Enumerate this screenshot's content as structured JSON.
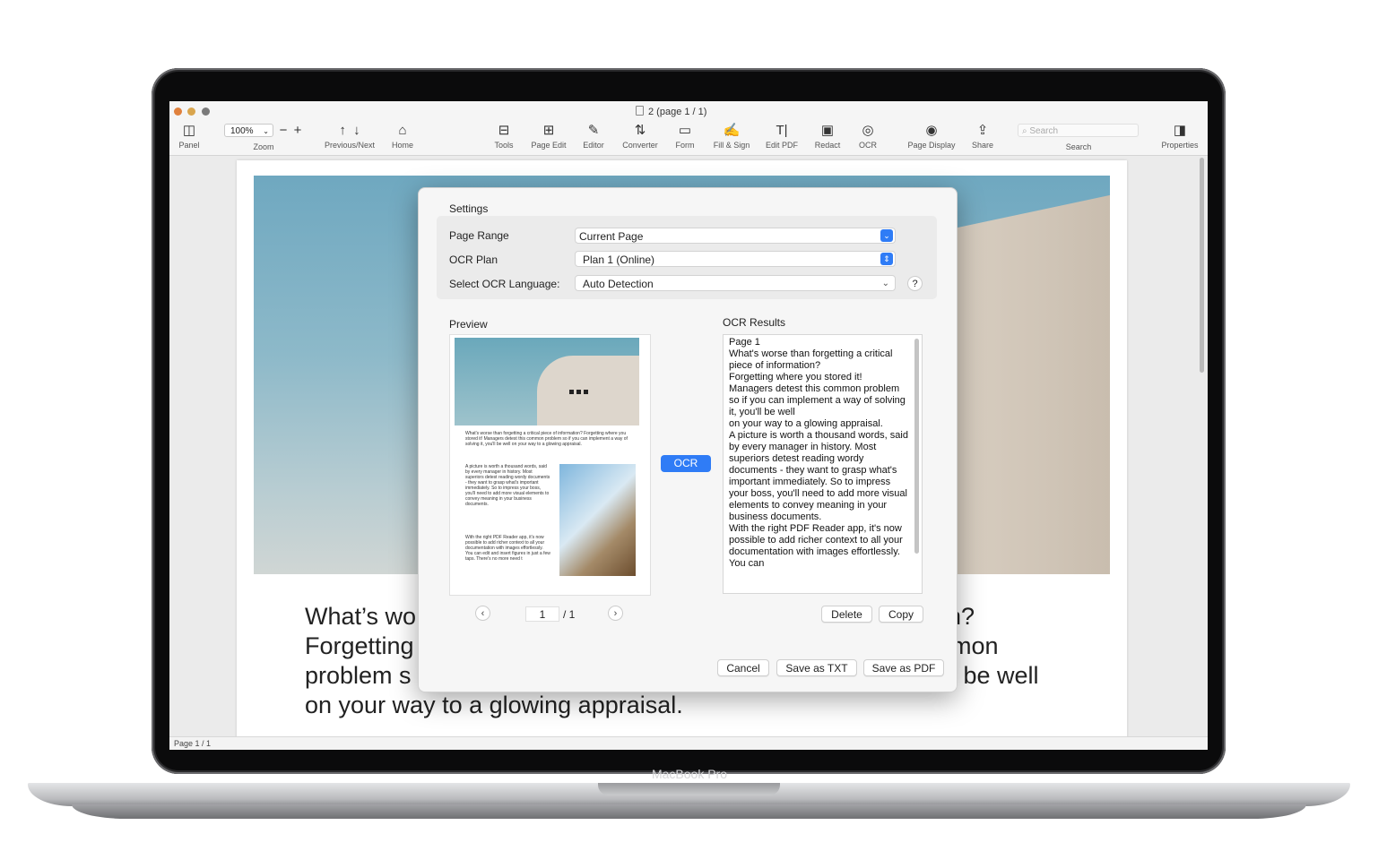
{
  "device": {
    "brand": "MacBook Pro"
  },
  "window": {
    "title": "2 (page 1 / 1)",
    "traffic_colors": [
      "#e0813d",
      "#d9a54d",
      "#7a7a7a"
    ]
  },
  "toolbar": {
    "panel": "Panel",
    "zoom_value": "100%",
    "zoom_minus": "−",
    "zoom_plus": "+",
    "zoom": "Zoom",
    "prev_next": "Previous/Next",
    "home": "Home",
    "tools": "Tools",
    "page_edit": "Page Edit",
    "editor": "Editor",
    "converter": "Converter",
    "form": "Form",
    "fill_sign": "Fill & Sign",
    "edit_pdf": "Edit PDF",
    "redact": "Redact",
    "ocr": "OCR",
    "page_display": "Page Display",
    "share": "Share",
    "search_placeholder": "Search",
    "search": "Search",
    "properties": "Properties"
  },
  "document": {
    "lines": [
      "What’s wo",
      "Forgetting",
      "problem s",
      "on your way to a glowing appraisal."
    ],
    "right_fragments": [
      "n?",
      "mon",
      "l be well"
    ]
  },
  "status": {
    "page_indicator": "Page 1 / 1"
  },
  "dialog": {
    "settings_title": "Settings",
    "page_range_label": "Page Range",
    "page_range_value": "Current Page",
    "ocr_plan_label": "OCR Plan",
    "ocr_plan_value": "Plan 1 (Online)",
    "language_label": "Select OCR Language:",
    "language_value": "Auto Detection",
    "help": "?",
    "preview_label": "Preview",
    "results_label": "OCR Results",
    "ocr_button": "OCR",
    "preview_para1": "What's worse than forgetting a critical piece of information? Forgetting where you stored it! Managers detest this common problem so if you can implement a way of solving it, you'll be well on your way to a glowing appraisal.",
    "preview_para2": "A picture is worth a thousand words, said by every manager in history. Most superiors detest reading wordy documents - they want to grasp what's important immediately. So to impress your boss, you'll need to add more visual elements to convey meaning in your business documents.",
    "preview_para3": "With the right PDF Reader app, it's now possible to add richer context to all your documentation with images effortlessly. You can edit and insert figures in just a few taps. There's no more need t",
    "results_text": "Page 1\nWhat's worse than forgetting a critical piece of information?\nForgetting where you stored it!\nManagers detest this common problem so if you can implement a way of solving it, you'll be well\non your way to a glowing appraisal.\nA picture is worth a thousand words, said by every manager in history. Most superiors detest reading wordy documents - they want to grasp what's important immediately. So to impress your boss, you'll need to add more visual elements to convey meaning in your business documents.\nWith the right PDF Reader app, it's now possible to add richer context to all your documentation with images effortlessly. You can",
    "page_current": "1",
    "page_total": "/ 1",
    "prev_arrow": "‹",
    "next_arrow": "›",
    "delete": "Delete",
    "copy": "Copy",
    "cancel": "Cancel",
    "save_txt": "Save as TXT",
    "save_pdf": "Save as PDF",
    "accent": "#2f7cf6"
  }
}
